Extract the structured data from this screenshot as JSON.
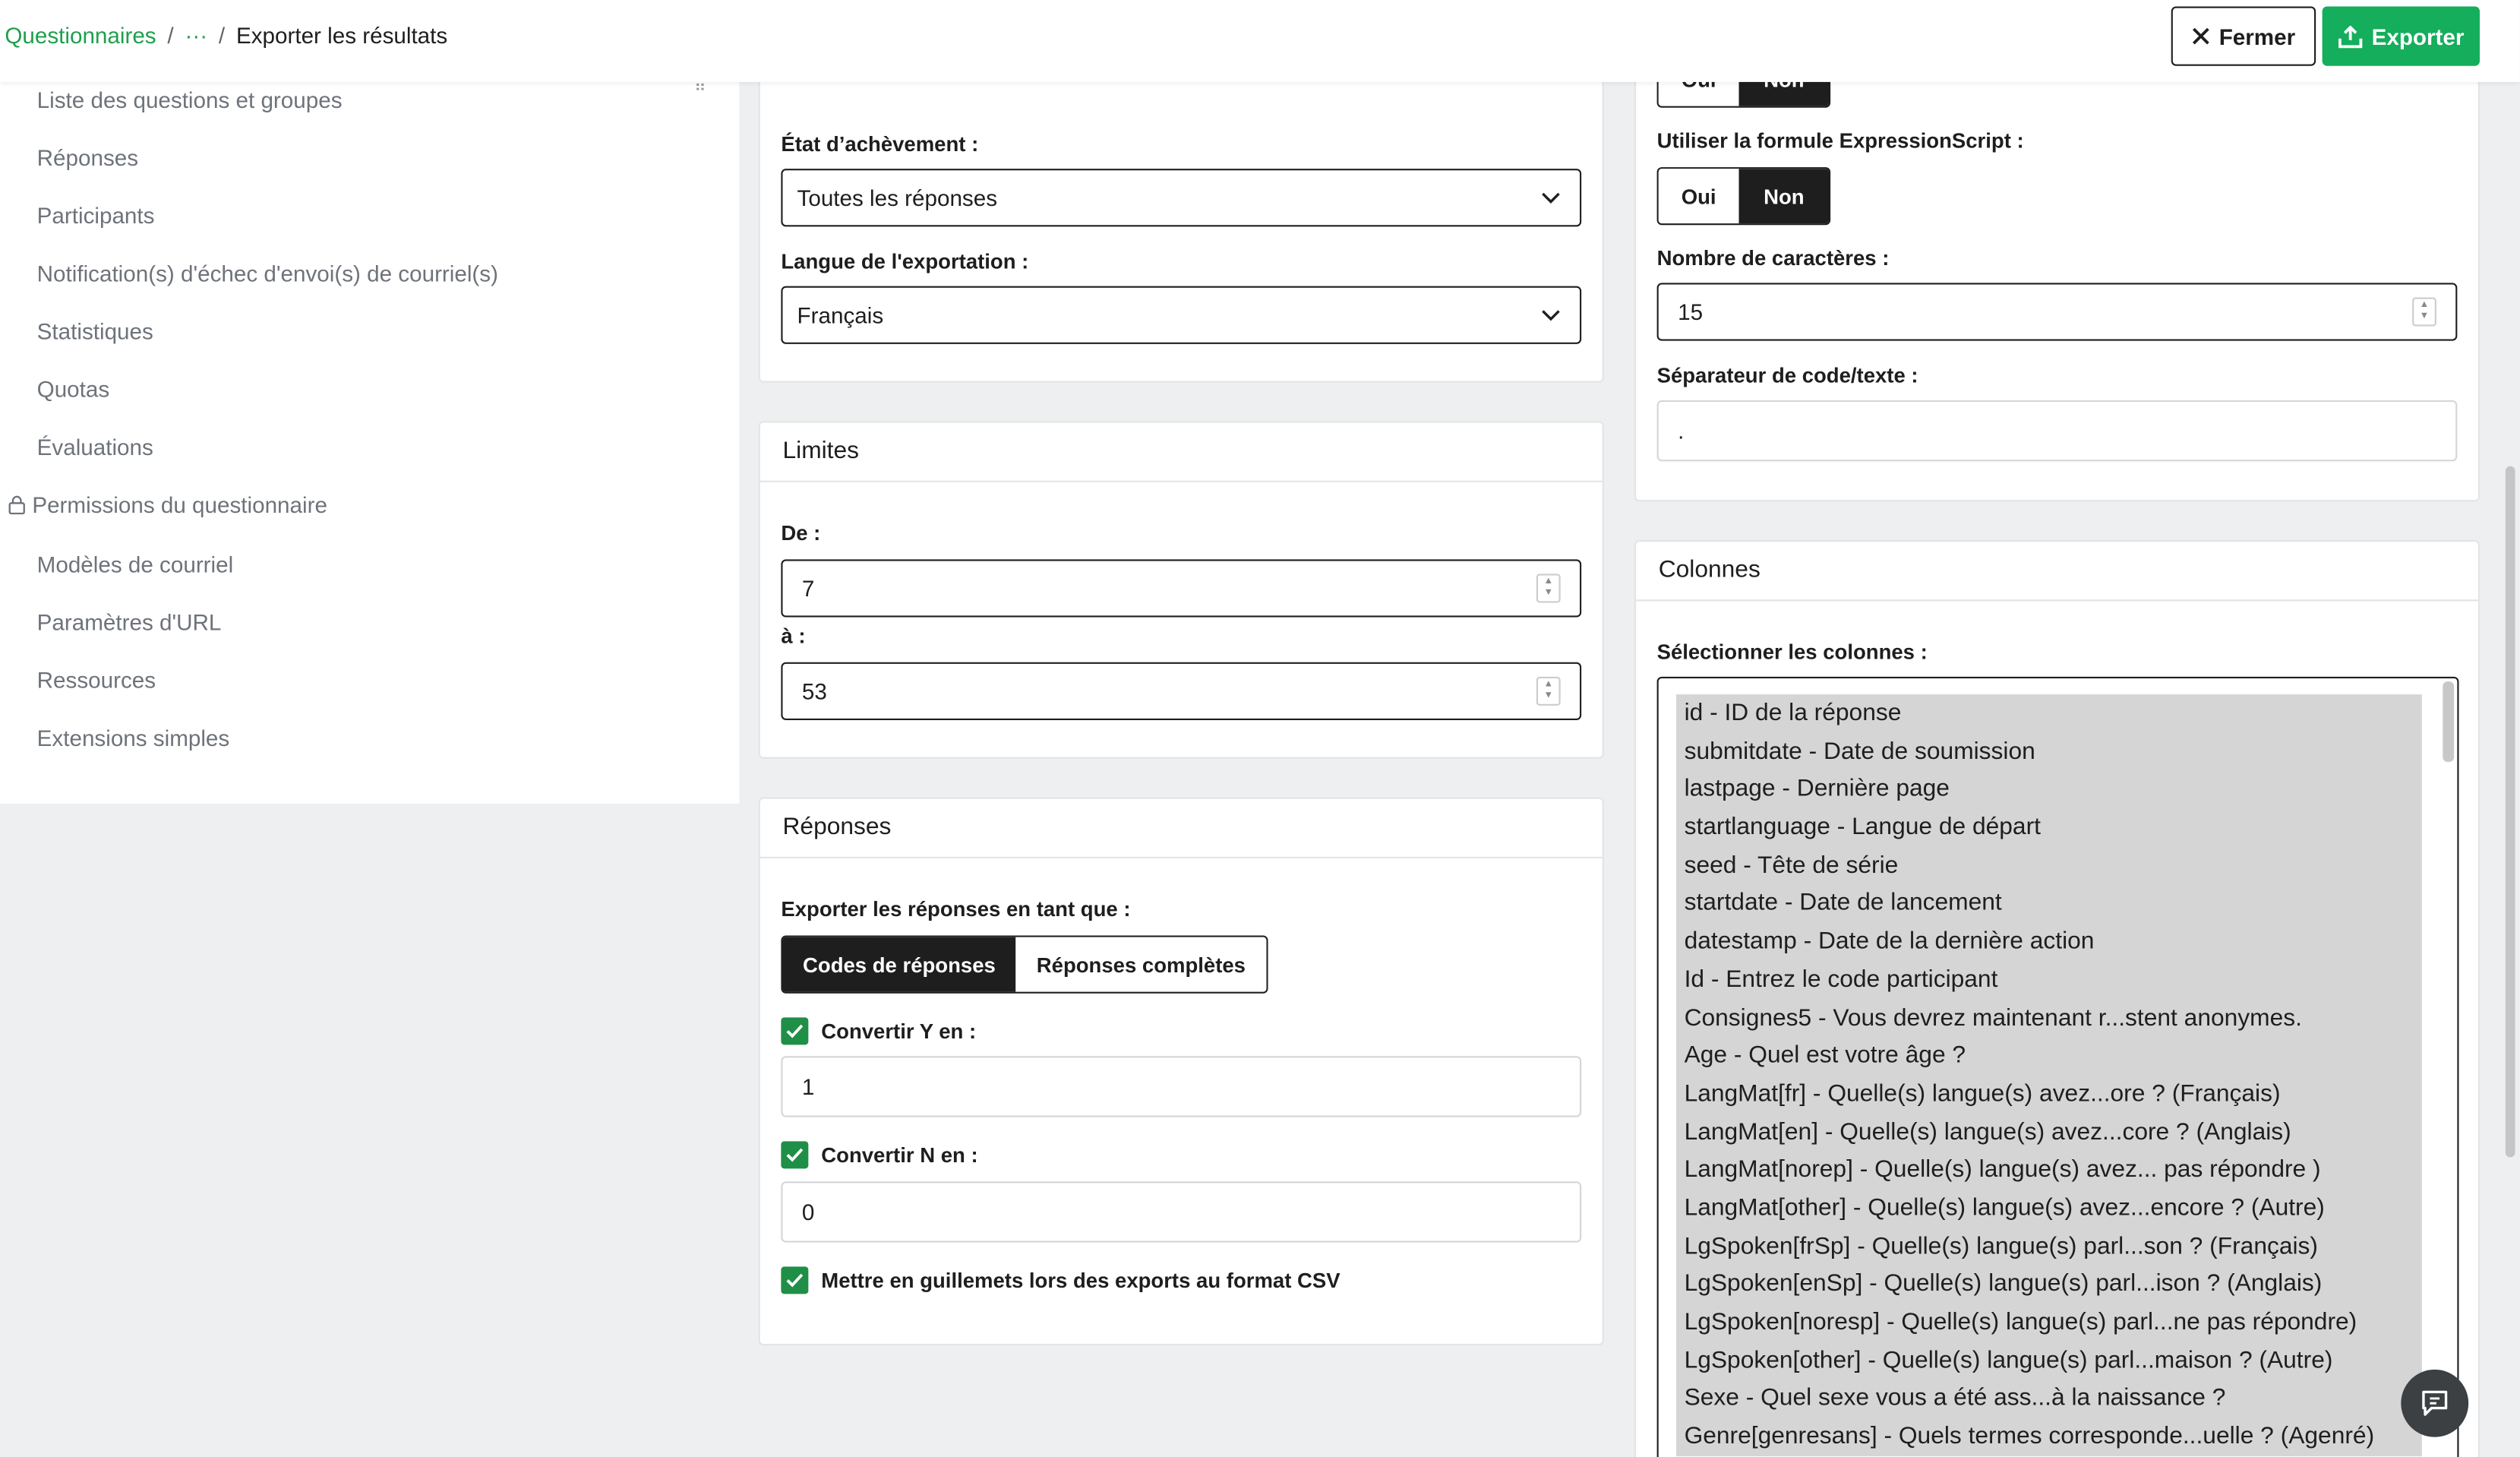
{
  "breadcrumb": {
    "root": "Questionnaires",
    "ellipsis": "···",
    "separator": "/",
    "current": "Exporter les résultats"
  },
  "actions": {
    "close_label": "Fermer",
    "export_label": "Exporter"
  },
  "sidebar": {
    "items": [
      "Liste des questions et groupes",
      "Réponses",
      "Participants",
      "Notification(s) d'échec d'envoi(s) de courriel(s)",
      "Statistiques",
      "Quotas",
      "Évaluations",
      "Permissions du questionnaire",
      "Modèles de courriel",
      "Paramètres d'URL",
      "Ressources",
      "Extensions simples"
    ]
  },
  "general": {
    "completion_label": "État d’achèvement :",
    "completion_value": "Toutes les réponses",
    "language_label": "Langue de l'exportation :",
    "language_value": "Français"
  },
  "limits": {
    "title": "Limites",
    "from_label": "De :",
    "from_value": "7",
    "to_label": "à :",
    "to_value": "53"
  },
  "responses": {
    "title": "Réponses",
    "export_as_label": "Exporter les réponses en tant que :",
    "codes_label": "Codes de réponses",
    "full_label": "Réponses complètes",
    "convert_y_label": "Convertir Y en :",
    "convert_y_value": "1",
    "convert_n_label": "Convertir N en :",
    "convert_n_value": "0",
    "quote_csv_label": "Mettre en guillemets lors des exports au format CSV"
  },
  "headings": {
    "top_oui": "Oui",
    "top_non": "Non",
    "expression_label": "Utiliser la formule ExpressionScript :",
    "oui": "Oui",
    "non": "Non",
    "chars_label": "Nombre de caractères :",
    "chars_value": "15",
    "separator_label": "Séparateur de code/texte :",
    "separator_value": "."
  },
  "columns": {
    "title": "Colonnes",
    "select_label": "Sélectionner les colonnes :",
    "options": [
      "id - ID de la réponse",
      "submitdate - Date de soumission",
      "lastpage - Dernière page",
      "startlanguage - Langue de départ",
      "seed - Tête de série",
      "startdate - Date de lancement",
      "datestamp - Date de la dernière action",
      "Id - Entrez le code participant",
      "Consignes5 - Vous devrez maintenant r...stent anonymes.",
      "Age - Quel est votre âge ?",
      "LangMat[fr] - Quelle(s) langue(s) avez...ore ? (Français)",
      "LangMat[en] - Quelle(s) langue(s) avez...core ? (Anglais)",
      "LangMat[norep] - Quelle(s) langue(s) avez... pas répondre )",
      "LangMat[other] - Quelle(s) langue(s) avez...encore ? (Autre)",
      "LgSpoken[frSp] - Quelle(s) langue(s) parl...son ? (Français)",
      "LgSpoken[enSp] - Quelle(s) langue(s) parl...ison ? (Anglais)",
      "LgSpoken[noresp] - Quelle(s) langue(s) parl...ne pas répondre)",
      "LgSpoken[other] - Quelle(s) langue(s) parl...maison ? (Autre)",
      "Sexe - Quel sexe vous a été ass...à la naissance ?",
      "Genre[genresans] - Quels termes corresponde...uelle ? (Agenré)"
    ]
  }
}
